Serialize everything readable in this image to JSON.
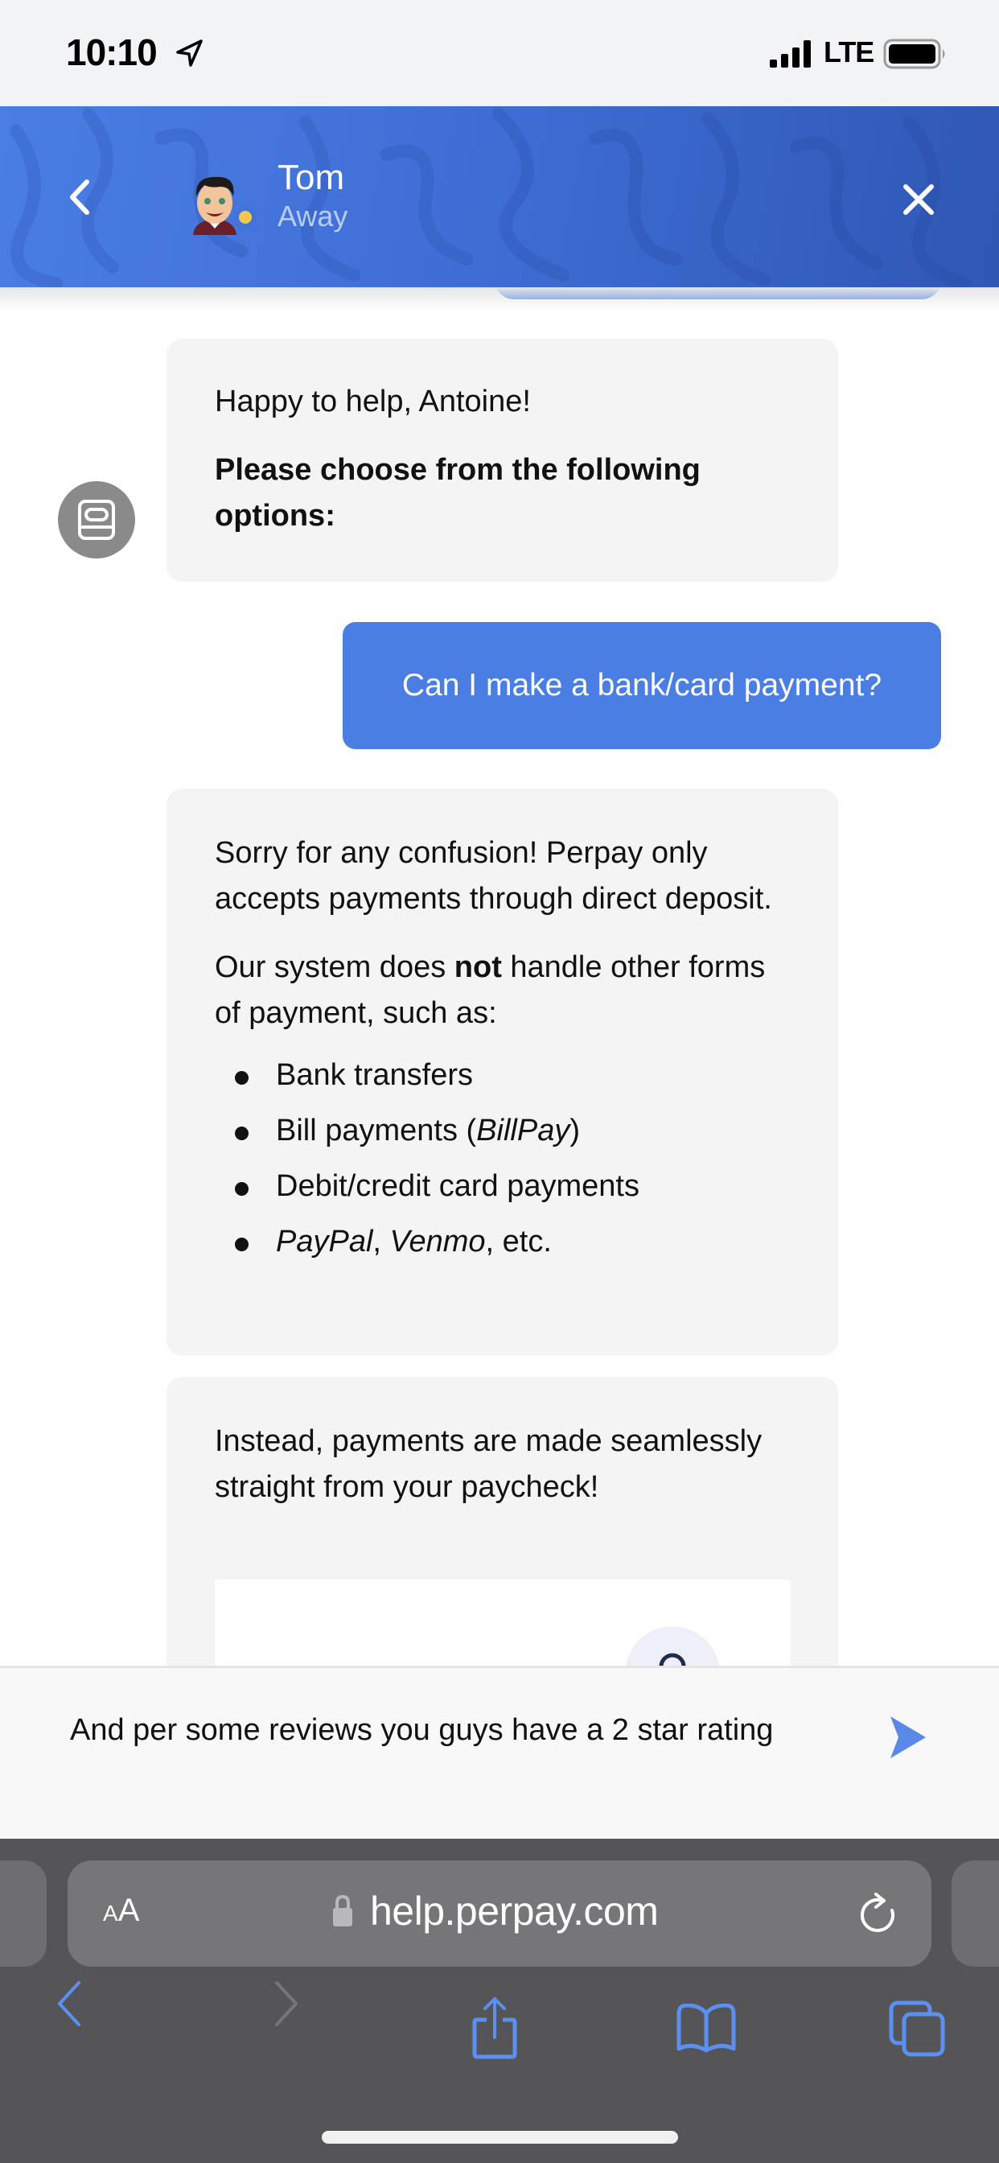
{
  "status_bar": {
    "time": "10:10",
    "network": "LTE",
    "icons": [
      "location-arrow-icon",
      "signal-bars-icon",
      "battery-icon"
    ]
  },
  "chat_header": {
    "agent_name": "Tom",
    "agent_status": "Away",
    "presence_color": "#f2c94c",
    "back_icon": "chevron-left-icon",
    "close_icon": "close-icon",
    "brand_color": "#4372d8"
  },
  "messages": [
    {
      "sender": "bot",
      "paragraphs": [
        {
          "text": "Happy to help, Antoine!"
        },
        {
          "text": "Please choose from the following options:",
          "bold": true
        }
      ]
    },
    {
      "sender": "user",
      "text": "Can I make a bank/card payment?"
    },
    {
      "sender": "bot",
      "paragraph_1": "Sorry for any confusion! Perpay only accepts payments through direct deposit.",
      "paragraph_2": {
        "before": "Our system does ",
        "bold": "not",
        "after": " handle other forms of payment, such as:"
      },
      "bullets": [
        {
          "text": "Bank transfers"
        },
        {
          "before": "Bill payments (",
          "italic": "BillPay",
          "after": ")"
        },
        {
          "text": "Debit/credit card payments"
        },
        {
          "italic_1": "PayPal",
          "sep": ", ",
          "italic_2": "Venmo",
          "after": ", etc."
        }
      ]
    },
    {
      "sender": "bot",
      "text": "Instead, payments are made seamlessly straight from your paycheck!"
    }
  ],
  "composer": {
    "value": "And per some reviews you guys have a 2 star rating",
    "send_icon": "send-icon",
    "accent_color": "#5b8ae6"
  },
  "safari": {
    "aa_label_small": "A",
    "aa_label_large": "A",
    "url": "help.perpay.com",
    "toolbar": [
      "back-icon",
      "forward-icon",
      "share-icon",
      "bookmarks-icon",
      "tabs-icon"
    ],
    "toolbar_color": "#5b8ff0"
  }
}
